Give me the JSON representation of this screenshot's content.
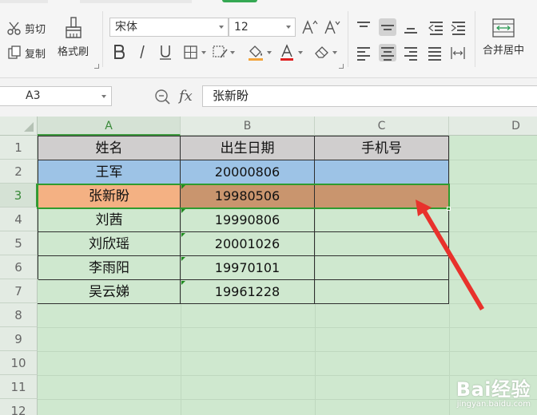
{
  "ribbon": {
    "cut_label": "剪切",
    "copy_label": "复制",
    "format_painter_label": "格式刷",
    "font_name": "宋体",
    "font_size": "12",
    "merge_center_label": "合并居中"
  },
  "formula_bar": {
    "cell_ref": "A3",
    "fx_label": "fx",
    "content": "张新盼"
  },
  "sheet": {
    "columns": [
      "A",
      "B",
      "C",
      "D"
    ],
    "rows": [
      "1",
      "2",
      "3",
      "4",
      "5",
      "6",
      "7",
      "8",
      "9",
      "10",
      "11",
      "12"
    ],
    "header": [
      "姓名",
      "出生日期",
      "手机号"
    ],
    "data": [
      [
        "王军",
        "20000806",
        ""
      ],
      [
        "张新盼",
        "19980506",
        ""
      ],
      [
        "刘茜",
        "19990806",
        ""
      ],
      [
        "刘欣瑶",
        "20001026",
        ""
      ],
      [
        "李雨阳",
        "19970101",
        ""
      ],
      [
        "吴云娣",
        "19961228",
        ""
      ]
    ],
    "colors": {
      "header_fill": "#d0cece",
      "row2_fill": "#9dc3e6",
      "row3_a_fill": "#f4b183",
      "row3_bc_fill": "#c9956e",
      "grid_bg": "#cfe8cf",
      "arrow": "#e8322c"
    }
  },
  "watermark": {
    "brand": "Bai经验",
    "url": "jingyan.baidu.com"
  }
}
